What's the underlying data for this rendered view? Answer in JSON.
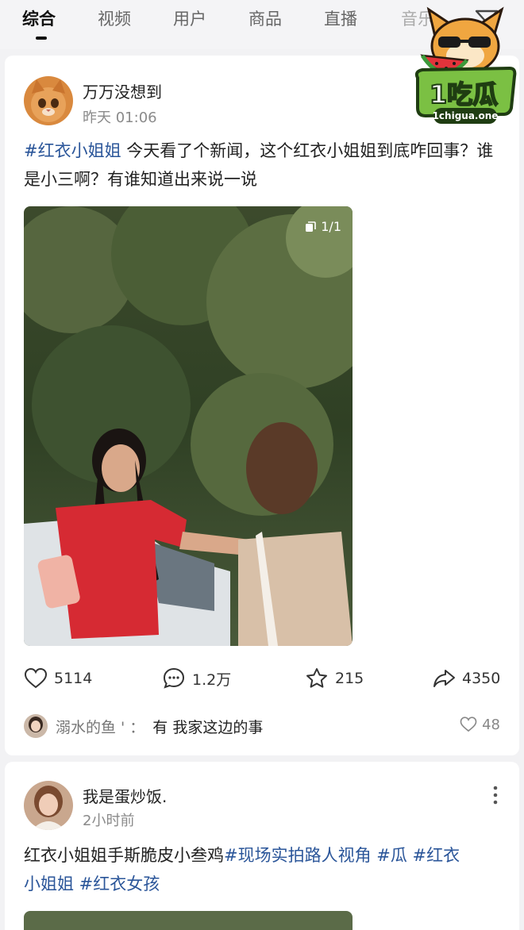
{
  "tabs": [
    {
      "label": "综合"
    },
    {
      "label": "视频"
    },
    {
      "label": "用户"
    },
    {
      "label": "商品"
    },
    {
      "label": "直播"
    },
    {
      "label": "音乐"
    }
  ],
  "posts": [
    {
      "username": "万万没想到",
      "time": "昨天 01:06",
      "hashtag": "#红衣小姐姐",
      "text": " 今天看了个新闻，这个红衣小姐姐到底咋回事？谁是小三啊？有谁知道出来说一说",
      "photo_counter": "1/1",
      "likes": "5114",
      "comments": "1.2万",
      "favorites": "215",
      "shares": "4350",
      "top_comment": {
        "author": "溺水的鱼 '",
        "separator": "：",
        "text": "有 我家这边的事",
        "likes": "48"
      }
    },
    {
      "username": "我是蛋炒饭.",
      "time": "2小时前",
      "text_plain": "红衣小姐姐手斯脆皮小叁鸡",
      "hashtags_line1": "#现场实拍路人视角 #瓜 #红衣",
      "hashtags_line2": "小姐姐 #红衣女孩"
    }
  ],
  "watermark": {
    "brand": "1吃瓜",
    "domain": "1chigua.one"
  },
  "colors": {
    "hashtag": "#2a5599",
    "background": "#f2f2f4",
    "card": "#ffffff"
  }
}
